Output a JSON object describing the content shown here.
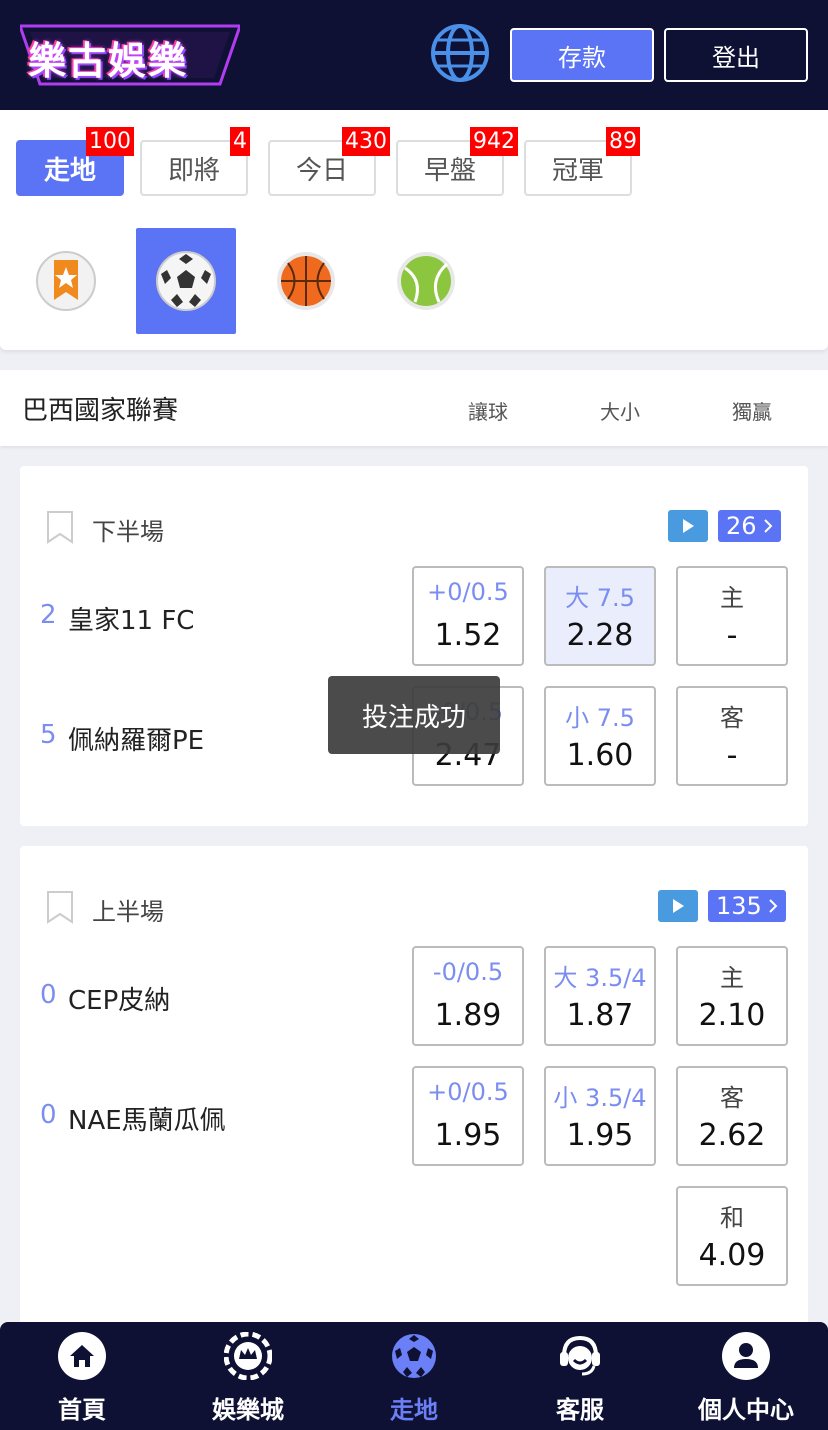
{
  "header": {
    "logo_text": "樂古娛樂",
    "deposit_label": "存款",
    "logout_label": "登出"
  },
  "tabs": [
    {
      "label": "走地",
      "count": "100",
      "active": true
    },
    {
      "label": "即將",
      "count": "4"
    },
    {
      "label": "今日",
      "count": "430"
    },
    {
      "label": "早盤",
      "count": "942"
    },
    {
      "label": "冠軍",
      "count": "89"
    }
  ],
  "sports": [
    {
      "icon": "favorites-star-icon"
    },
    {
      "icon": "soccer-ball-icon",
      "active": true
    },
    {
      "icon": "basketball-icon"
    },
    {
      "icon": "tennis-ball-icon"
    }
  ],
  "league": {
    "name": "巴西國家聯賽",
    "col_handicap": "讓球",
    "col_overunder": "大小",
    "col_winner": "獨贏"
  },
  "matches": [
    {
      "period": "下半場",
      "more_count": "26",
      "home": {
        "score": "2",
        "name": "皇家11 FC"
      },
      "away": {
        "score": "5",
        "name": "佩納羅爾PE"
      },
      "odds": {
        "hdp_home_line": "+0/0.5",
        "hdp_home": "1.52",
        "hdp_away_line": "-0/0.5",
        "hdp_away": "2.47",
        "ou_over_line": "大 7.5",
        "ou_over": "2.28",
        "ou_under_line": "小 7.5",
        "ou_under": "1.60",
        "win_home_label": "主",
        "win_home": "-",
        "win_away_label": "客",
        "win_away": "-"
      }
    },
    {
      "period": "上半場",
      "more_count": "135",
      "home": {
        "score": "0",
        "name": "CEP皮納"
      },
      "away": {
        "score": "0",
        "name": "NAE馬蘭瓜佩"
      },
      "odds": {
        "hdp_home_line": "-0/0.5",
        "hdp_home": "1.89",
        "hdp_away_line": "+0/0.5",
        "hdp_away": "1.95",
        "ou_over_line": "大 3.5/4",
        "ou_over": "1.87",
        "ou_under_line": "小 3.5/4",
        "ou_under": "1.95",
        "win_home_label": "主",
        "win_home": "2.10",
        "win_away_label": "客",
        "win_away": "2.62",
        "win_draw_label": "和",
        "win_draw": "4.09"
      }
    }
  ],
  "toast": "投注成功",
  "bottom_nav": [
    {
      "label": "首頁",
      "icon": "home-icon"
    },
    {
      "label": "娛樂城",
      "icon": "casino-chip-icon"
    },
    {
      "label": "走地",
      "icon": "soccer-ball-icon",
      "active": true
    },
    {
      "label": "客服",
      "icon": "customer-service-icon"
    },
    {
      "label": "個人中心",
      "icon": "user-icon"
    }
  ],
  "colors": {
    "header_bg": "#0e1133",
    "accent": "#5b73f5",
    "badge_red": "#ff0000",
    "score_blue": "#7b8ef0"
  }
}
